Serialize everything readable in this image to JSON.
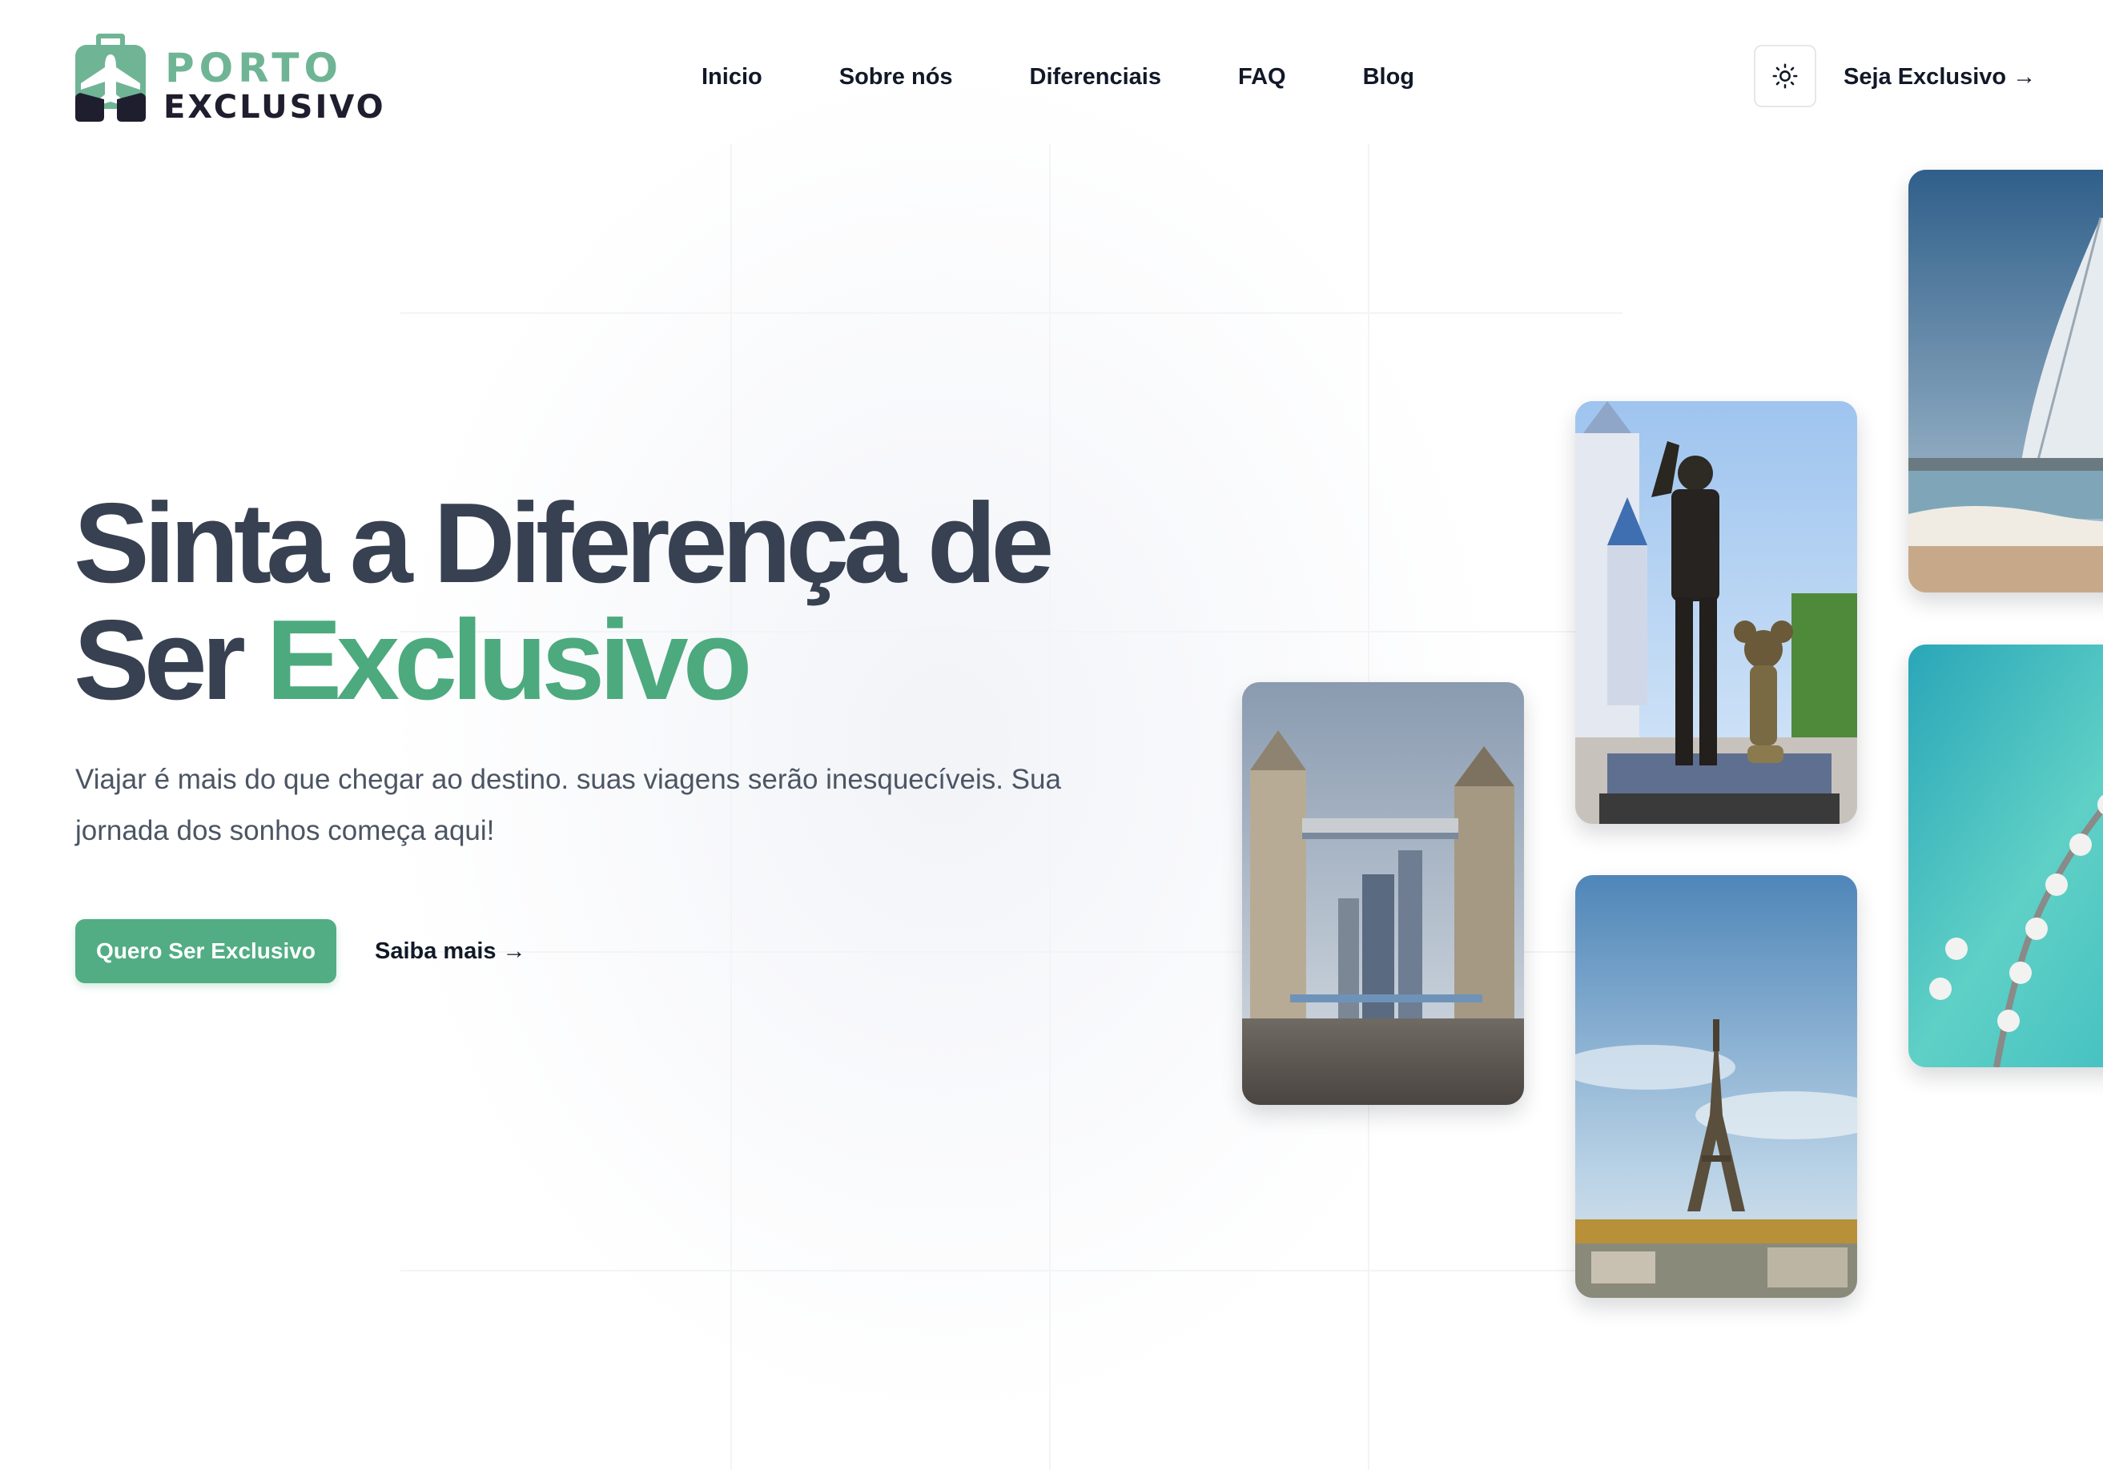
{
  "brand": {
    "name_top": "PORTO",
    "name_bottom": "EXCLUSIVO",
    "primary_color": "#52ad84",
    "dark_color": "#1f1e2e"
  },
  "nav": {
    "items": [
      {
        "label": "Inicio"
      },
      {
        "label": "Sobre nós"
      },
      {
        "label": "Diferenciais"
      },
      {
        "label": "FAQ"
      },
      {
        "label": "Blog"
      }
    ],
    "theme_toggle_icon": "sun-icon",
    "cta_label": "Seja Exclusivo",
    "cta_arrow": "→"
  },
  "hero": {
    "title_line1": "Sinta a Diferença de",
    "title_line2_plain": "Ser ",
    "title_line2_accent": "Exclusivo",
    "subtitle": "Viajar é mais do que chegar ao destino. suas viagens serão inesquecíveis. Sua jornada dos sonhos começa aqui!",
    "primary_button": "Quero Ser Exclusivo",
    "secondary_link": "Saiba mais",
    "secondary_arrow": "→",
    "title_color": "#374151",
    "accent_color": "#4caa7e"
  },
  "gallery": {
    "photos": [
      {
        "subject": "london-tower-bridge-photo"
      },
      {
        "subject": "disney-partners-statue-photo"
      },
      {
        "subject": "paris-eiffel-tower-photo"
      },
      {
        "subject": "dubai-burj-al-arab-photo"
      },
      {
        "subject": "maldives-water-villas-photo"
      }
    ]
  }
}
